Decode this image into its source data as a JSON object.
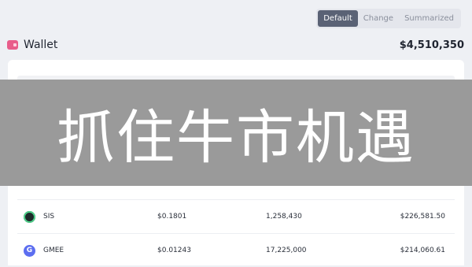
{
  "view_tabs": [
    {
      "label": "Default",
      "active": true
    },
    {
      "label": "Change",
      "active": false
    },
    {
      "label": "Summarized",
      "active": false
    }
  ],
  "wallet": {
    "title": "Wallet",
    "total": "$4,510,350",
    "icon": "wallet-icon"
  },
  "overlay": {
    "text": "抓住牛市机遇"
  },
  "rows": [
    {
      "token": "SIS",
      "icon": "sis-coin-icon",
      "price": "$0.1801",
      "amount": "1,258,430",
      "value": "$226,581.50"
    },
    {
      "token": "GMEE",
      "icon": "gmee-coin-icon",
      "price": "$0.01243",
      "amount": "17,225,000",
      "value": "$214,060.61"
    }
  ],
  "colors": {
    "accent": "#5a6275",
    "wallet_icon": "#e85d8a",
    "overlay": "#9a9a9a",
    "gmee": "#5c6ef0",
    "sis": "#4fd18b"
  }
}
